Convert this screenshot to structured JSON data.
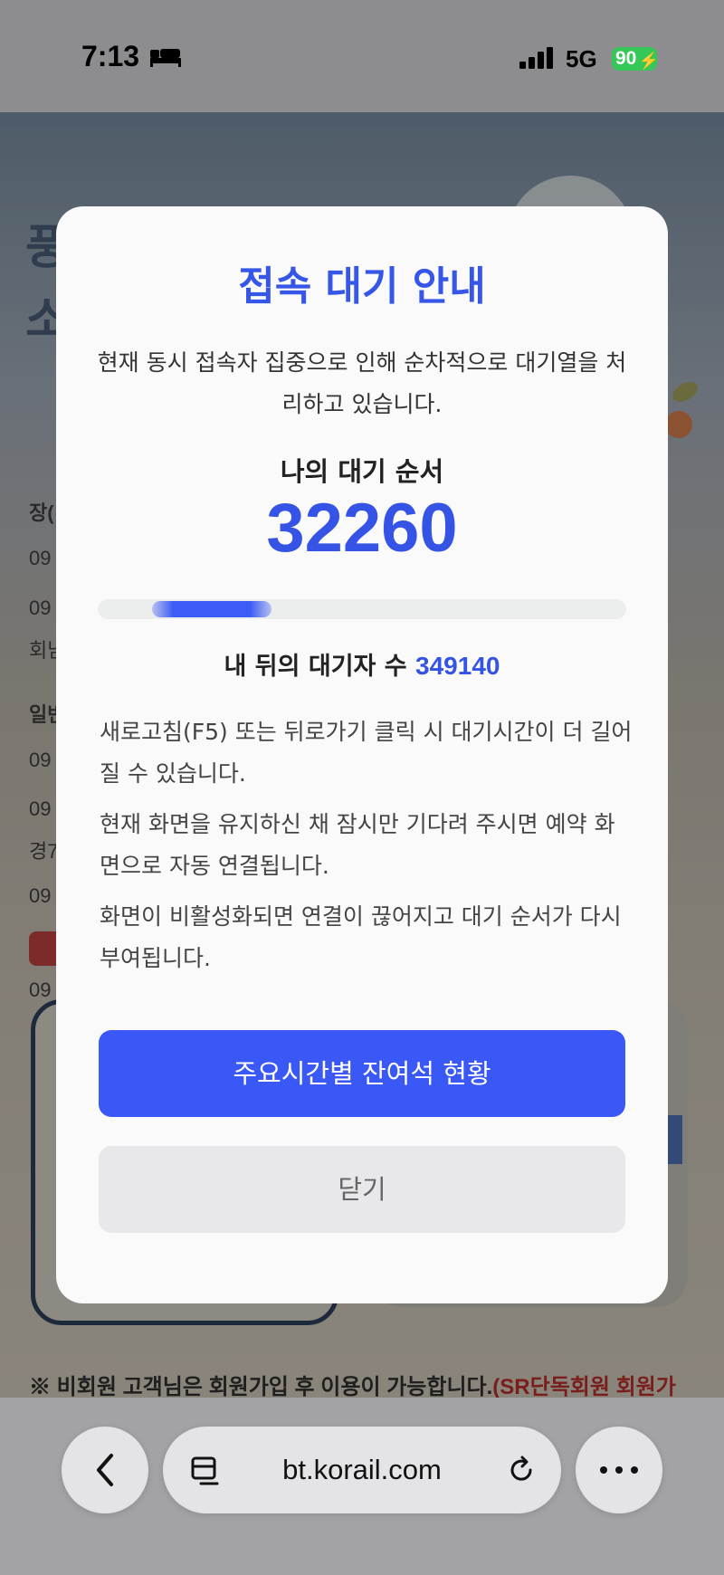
{
  "status_bar": {
    "time": "7:13",
    "network": "5G",
    "battery": "90"
  },
  "background_page": {
    "heading_lines": [
      "풍",
      "소"
    ],
    "side_lines": [
      "장(",
      "09",
      "09",
      "회남",
      "일반",
      "09",
      "09",
      "경7",
      "09",
      "09",
      "09"
    ],
    "notice_main": "※ 비회원 고객님은 회원가입 후 이용이 가능합니다.",
    "notice_red": "(SR단독회원 회원가"
  },
  "modal": {
    "title": "접속 대기 안내",
    "description": "현재 동시 접속자 집중으로 인해 순차적으로 대기열을 처리하고 있습니다.",
    "queue_label": "나의 대기 순서",
    "queue_number": "32260",
    "progress_fraction": 0.08,
    "behind_label": "내 뒤의 대기자 수",
    "behind_count": "349140",
    "notices": [
      "새로고침(F5) 또는 뒤로가기 클릭 시 대기시간이 더 길어질 수 있습니다.",
      "현재 화면을 유지하신 채 잠시만 기다려 주시면 예약 화면으로 자동 연결됩니다.",
      "화면이 비활성화되면 연결이 끊어지고 대기 순서가 다시 부여됩니다."
    ],
    "primary_button": "주요시간별 잔여석 현황",
    "close_button": "닫기"
  },
  "browser": {
    "url": "bt.korail.com"
  },
  "colors": {
    "accent": "#3556e6",
    "button_primary": "#3a58f6",
    "button_secondary": "#e8e8ea",
    "battery": "#36c759"
  },
  "icons": [
    "bed-icon",
    "signal-icon",
    "battery-icon",
    "back-icon",
    "tabs-icon",
    "reload-icon",
    "more-icon"
  ]
}
